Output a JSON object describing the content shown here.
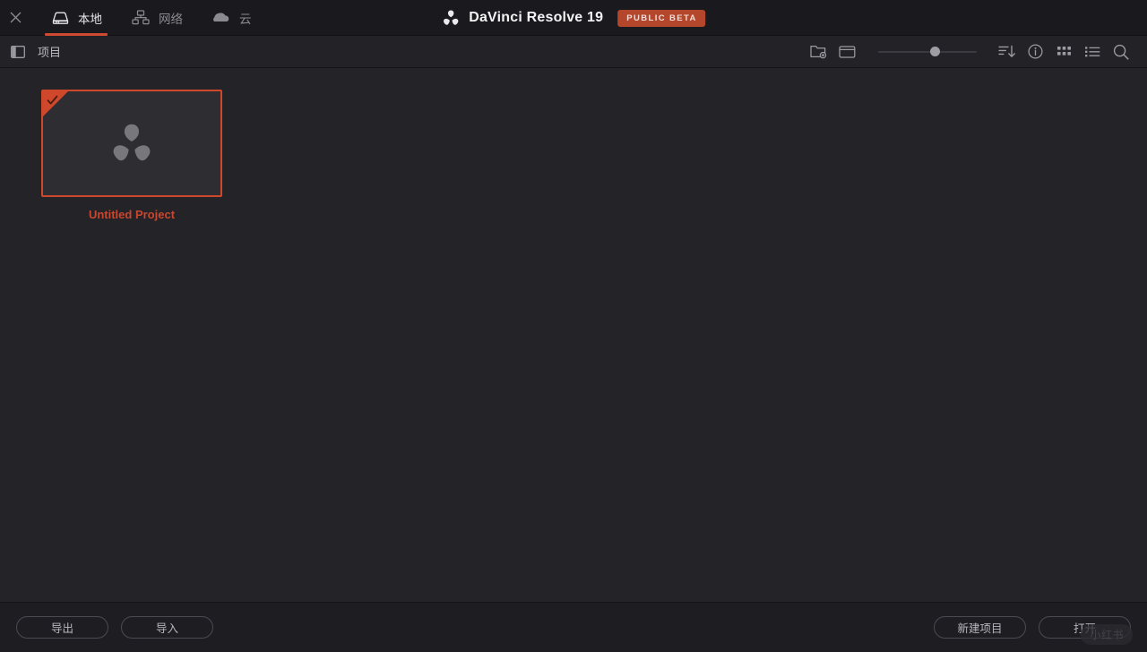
{
  "window": {
    "close_label": "×"
  },
  "header": {
    "tabs": [
      {
        "id": "local",
        "label": "本地",
        "icon": "hard-drive-icon",
        "active": true
      },
      {
        "id": "network",
        "label": "网络",
        "icon": "network-icon",
        "active": false
      },
      {
        "id": "cloud",
        "label": "云",
        "icon": "cloud-icon",
        "active": false
      }
    ],
    "brand": {
      "logo": "davinci-resolve-logo",
      "title": "DaVinci Resolve 19",
      "badge": "PUBLIC BETA"
    }
  },
  "toolbar": {
    "panel_toggle_icon": "sidebar-toggle-icon",
    "title": "项目",
    "new_folder_icon": "new-folder-icon",
    "new_window_icon": "new-window-icon",
    "zoom": {
      "value": 58,
      "min": 0,
      "max": 100
    },
    "sort_icon": "sort-descending-icon",
    "info_icon": "info-icon",
    "grid_view_icon": "grid-view-icon",
    "list_view_icon": "list-view-icon",
    "search_icon": "search-icon"
  },
  "projects": [
    {
      "name": "Untitled Project",
      "selected": true,
      "thumb_icon": "davinci-resolve-logo"
    }
  ],
  "footer": {
    "export_label": "导出",
    "import_label": "导入",
    "new_project_label": "新建项目",
    "open_label": "打开"
  },
  "overlay": {
    "watermark": "小红书"
  },
  "colors": {
    "accent": "#d0482c",
    "badge_bg": "#b4462c",
    "project_label": "#c9472f",
    "header_bg": "#1a1a1e",
    "toolbar_bg": "#232327",
    "content_bg": "#232328",
    "footer_bg": "#1e1e22"
  }
}
